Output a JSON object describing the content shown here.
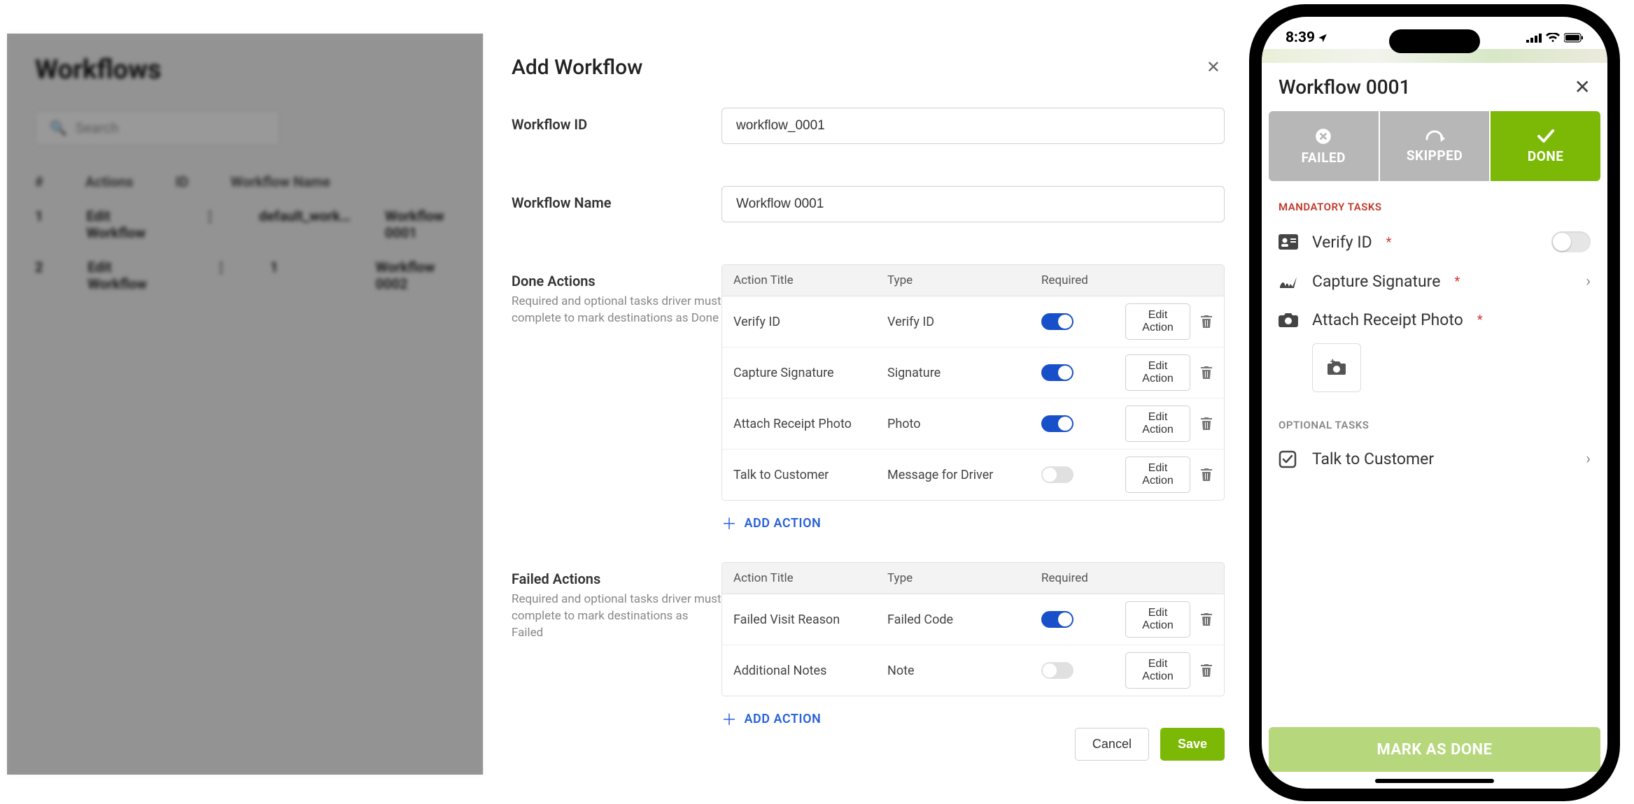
{
  "background": {
    "title": "Workflows",
    "search_placeholder": "Search",
    "columns": [
      "#",
      "Actions",
      "",
      "ID",
      "Workflow Name"
    ],
    "rows": [
      [
        "1",
        "Edit Workflow",
        "⋮",
        "default_work…",
        "Workflow 0001"
      ],
      [
        "2",
        "Edit Workflow",
        "⋮",
        "1",
        "Workflow 0002"
      ]
    ]
  },
  "dialog": {
    "title": "Add Workflow",
    "fields": {
      "workflow_id_label": "Workflow ID",
      "workflow_id_value": "workflow_0001",
      "workflow_name_label": "Workflow Name",
      "workflow_name_value": "Workflow 0001"
    },
    "done_actions": {
      "header": "Done Actions",
      "subtext": "Required and optional tasks driver must complete to mark destinations as Done",
      "columns": {
        "title": "Action Title",
        "type": "Type",
        "required": "Required"
      },
      "rows": [
        {
          "title": "Verify ID",
          "type": "Verify ID",
          "required": true
        },
        {
          "title": "Capture Signature",
          "type": "Signature",
          "required": true
        },
        {
          "title": "Attach Receipt Photo",
          "type": "Photo",
          "required": true
        },
        {
          "title": "Talk to Customer",
          "type": "Message for Driver",
          "required": false
        }
      ],
      "edit_label": "Edit Action",
      "add_label": "ADD ACTION"
    },
    "failed_actions": {
      "header": "Failed Actions",
      "subtext": "Required and optional tasks driver must complete to mark destinations as Failed",
      "columns": {
        "title": "Action Title",
        "type": "Type",
        "required": "Required"
      },
      "rows": [
        {
          "title": "Failed Visit Reason",
          "type": "Failed Code",
          "required": true
        },
        {
          "title": "Additional Notes",
          "type": "Note",
          "required": false
        }
      ],
      "edit_label": "Edit Action",
      "add_label": "ADD ACTION"
    },
    "footer": {
      "cancel": "Cancel",
      "save": "Save"
    }
  },
  "mobile": {
    "status_time": "8:39",
    "header_title": "Workflow 0001",
    "segments": {
      "failed": "FAILED",
      "skipped": "SKIPPED",
      "done": "DONE"
    },
    "mandatory_label": "MANDATORY TASKS",
    "optional_label": "OPTIONAL TASKS",
    "tasks": {
      "verify_id": "Verify ID",
      "capture_signature": "Capture Signature",
      "attach_photo": "Attach Receipt Photo",
      "talk_customer": "Talk to Customer"
    },
    "mark_done": "MARK AS DONE"
  }
}
